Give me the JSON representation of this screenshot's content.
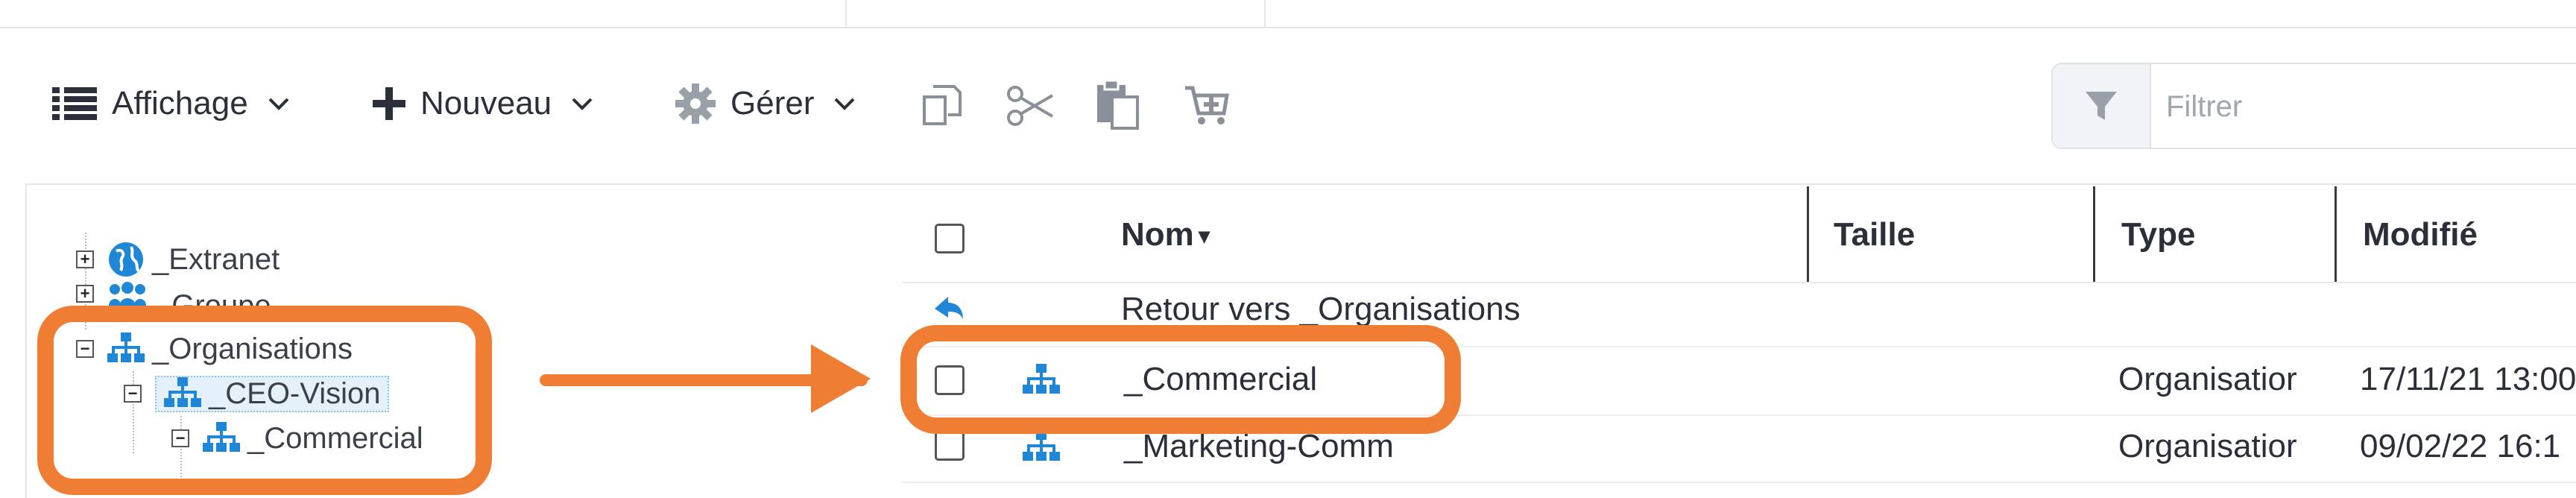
{
  "toolbar": {
    "display_label": "Affichage",
    "new_label": "Nouveau",
    "manage_label": "Gérer"
  },
  "filter": {
    "placeholder": "Filtrer"
  },
  "tree": {
    "extranet": "_Extranet",
    "groups": "_Groupe",
    "organisations": "_Organisations",
    "ceo_vision": "_CEO-Vision",
    "commercial": "_Commercial"
  },
  "list": {
    "columns": {
      "name": "Nom",
      "size": "Taille",
      "type": "Type",
      "modified": "Modifié"
    },
    "back_label": "Retour vers _Organisations",
    "rows": [
      {
        "name": "_Commercial",
        "type": "Organisatior",
        "modified": "17/11/21 13:00"
      },
      {
        "name": "_Marketing-Comm",
        "type": "Organisatior",
        "modified": "09/02/22 16:1"
      }
    ]
  },
  "colors": {
    "accent": "#ef7d33",
    "icon_blue": "#1f87d6",
    "text": "#2b2f3a"
  }
}
